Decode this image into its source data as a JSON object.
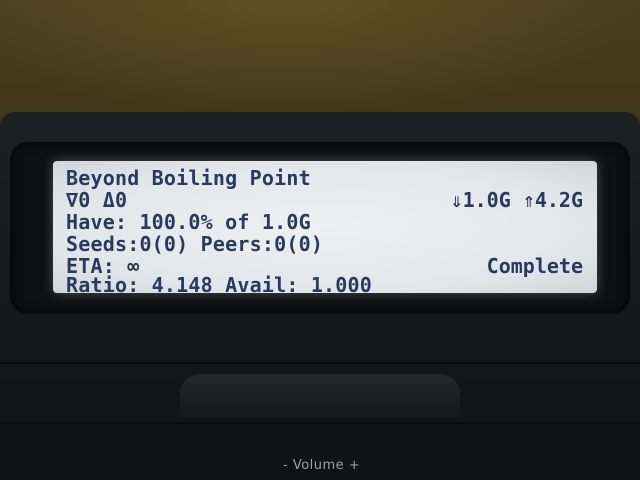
{
  "screen": {
    "title": "Beyond Boiling Point",
    "speed_line": "∇0 Δ0",
    "transfer": "⇓1.0G ⇑4.2G",
    "have": "Have: 100.0% of 1.0G",
    "seeds_peers": "Seeds:0(0) Peers:0(0)",
    "eta": "ETA: ∞",
    "status": "Complete",
    "ratio": "Ratio: 4.148 Avail: 1.000"
  },
  "device": {
    "volume_label": "- Volume +"
  }
}
